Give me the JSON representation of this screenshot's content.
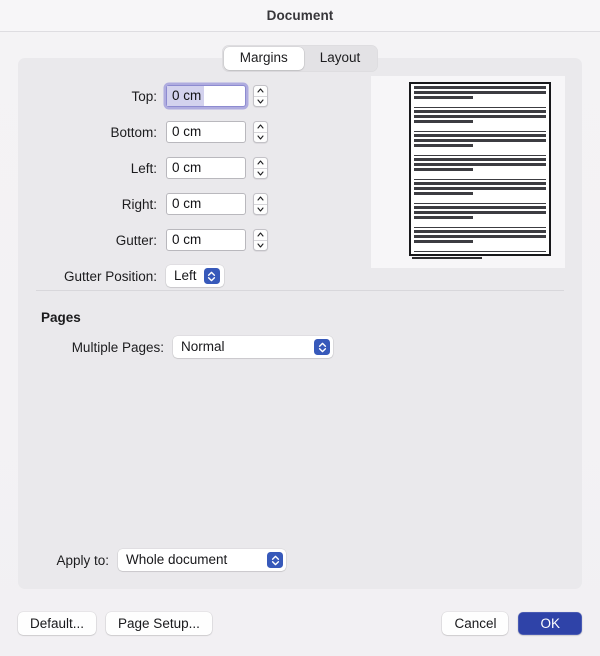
{
  "window": {
    "title": "Document"
  },
  "tabs": [
    {
      "label": "Margins",
      "selected": true
    },
    {
      "label": "Layout",
      "selected": false
    }
  ],
  "margins": {
    "fields": [
      {
        "label": "Top:",
        "value": "0 cm",
        "focused": true
      },
      {
        "label": "Bottom:",
        "value": "0 cm",
        "focused": false
      },
      {
        "label": "Left:",
        "value": "0 cm",
        "focused": false
      },
      {
        "label": "Right:",
        "value": "0 cm",
        "focused": false
      },
      {
        "label": "Gutter:",
        "value": "0 cm",
        "focused": false
      }
    ],
    "gutter_position": {
      "label": "Gutter Position:",
      "value": "Left"
    }
  },
  "pages": {
    "heading": "Pages",
    "multiple_pages": {
      "label": "Multiple Pages:",
      "value": "Normal"
    }
  },
  "apply_to": {
    "label": "Apply to:",
    "value": "Whole document"
  },
  "buttons": {
    "default": "Default...",
    "page_setup": "Page Setup...",
    "cancel": "Cancel",
    "ok": "OK"
  },
  "colors": {
    "accent_blue": "#3759ba",
    "default_button_blue": "#2f43a8",
    "focus_ring": "#8d8bd0",
    "selection": "#d3d2ee",
    "panel_bg": "#eae9ec",
    "dialog_bg": "#f3f2f4"
  },
  "icons": {
    "stepper_up": "chevron-up-icon",
    "stepper_down": "chevron-down-icon",
    "popup_indicator": "chevron-up-down-icon"
  }
}
